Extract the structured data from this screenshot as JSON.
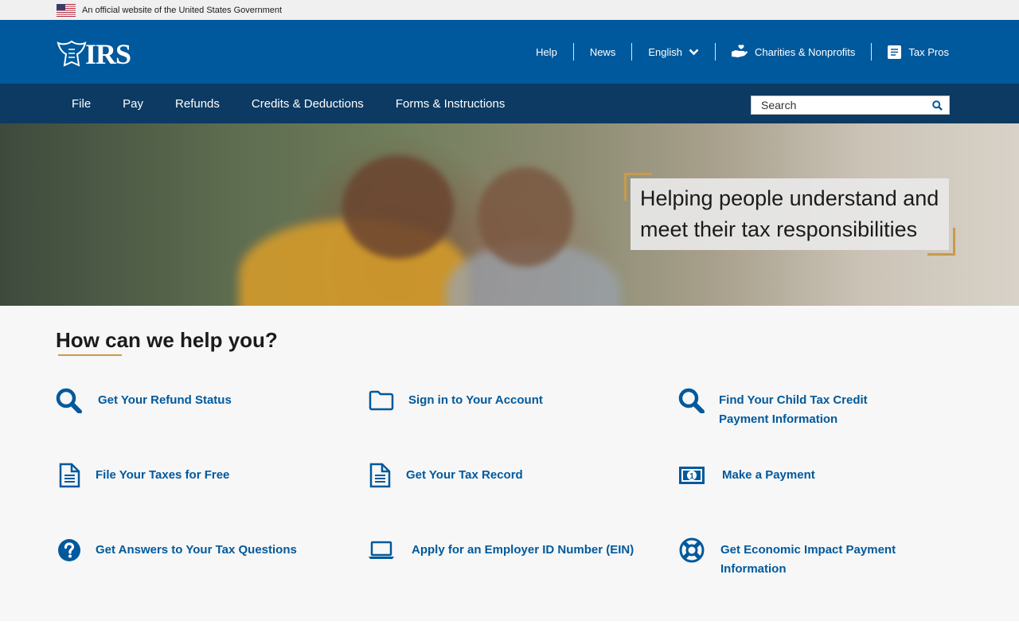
{
  "gov_banner": {
    "text": "An official website of the United States Government",
    "flag_icon": "us-flag-icon"
  },
  "header": {
    "logo_text": "IRS",
    "util_nav": [
      {
        "label": "Help"
      },
      {
        "label": "News"
      },
      {
        "label": "English",
        "icon": "chevron-down-icon"
      },
      {
        "label": "Charities & Nonprofits",
        "icon": "hand-heart-icon"
      },
      {
        "label": "Tax Pros",
        "icon": "book-icon"
      }
    ]
  },
  "main_nav": {
    "items": [
      "File",
      "Pay",
      "Refunds",
      "Credits & Deductions",
      "Forms & Instructions"
    ],
    "search_placeholder": "Search"
  },
  "hero": {
    "text": "Helping people understand and meet their tax responsibilities"
  },
  "help": {
    "title": "How can we help you?",
    "links": [
      {
        "label": "Get Your Refund Status",
        "icon": "search-icon"
      },
      {
        "label": "Sign in to Your Account",
        "icon": "folder-icon"
      },
      {
        "label": "Find Your Child Tax Credit Payment Information",
        "icon": "search-icon"
      },
      {
        "label": "File Your Taxes for Free",
        "icon": "document-icon"
      },
      {
        "label": "Get Your Tax Record",
        "icon": "document-icon"
      },
      {
        "label": "Make a Payment",
        "icon": "money-icon"
      },
      {
        "label": "Get Answers to Your Tax Questions",
        "icon": "question-icon"
      },
      {
        "label": "Apply for an Employer ID Number (EIN)",
        "icon": "laptop-icon"
      },
      {
        "label": "Get Economic Impact Payment Information",
        "icon": "life-ring-icon"
      }
    ]
  },
  "colors": {
    "header_blue": "#00599c",
    "nav_navy": "#0c3a62",
    "accent_gold": "#c99a4c",
    "link_blue": "#00599c"
  }
}
